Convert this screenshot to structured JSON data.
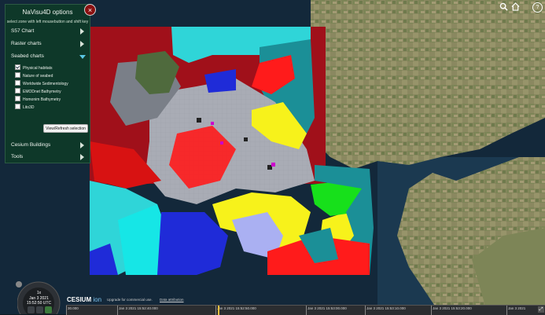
{
  "panel": {
    "title": "NaVisu4D options",
    "subtitle": "select zone with left mousebutton and shift key",
    "close": "×",
    "sections": {
      "s57": "S57 Chart",
      "raster": "Raster charts",
      "seabed": "Seabed charts",
      "buildings": "Cesium Buildings",
      "tools": "Tools"
    },
    "seabed_options": [
      {
        "label": "Physical habitats",
        "checked": true
      },
      {
        "label": "Nature of seabed",
        "checked": false
      },
      {
        "label": "Worldwide Sedimentology",
        "checked": false
      },
      {
        "label": "EMODnet Bathymetry",
        "checked": false
      },
      {
        "label": "Homonim Bathymetry",
        "checked": false
      },
      {
        "label": "Lito3D",
        "checked": false
      }
    ],
    "refresh_label": "View/Refresh selection"
  },
  "toolbar": {
    "search_icon": "search-icon",
    "home_icon": "home-icon",
    "help_label": "?"
  },
  "clock": {
    "speed": "1x",
    "date": "Jan 3 2021",
    "time": "15:52:50 UTC"
  },
  "credits": {
    "logo": "CESIUM",
    "logo_ion": "ion",
    "upgrade": "Upgrade for commercial use.",
    "attribution": "Data attribution"
  },
  "timeline": {
    "labels": [
      "30.000",
      "Jan 3 2021 15:52:40.000",
      "Jan 3 2021 15:52:50.000",
      "Jan 3 2021 15:53:00.000",
      "Jan 3 2021 15:53:10.000",
      "Jan 3 2021 15:53:20.000",
      "Jan 3 2021"
    ]
  },
  "colors": {
    "panel_bg": "#0e3a28",
    "close_btn": "#8a1010",
    "accent_triangle": "#5bc6e4"
  }
}
